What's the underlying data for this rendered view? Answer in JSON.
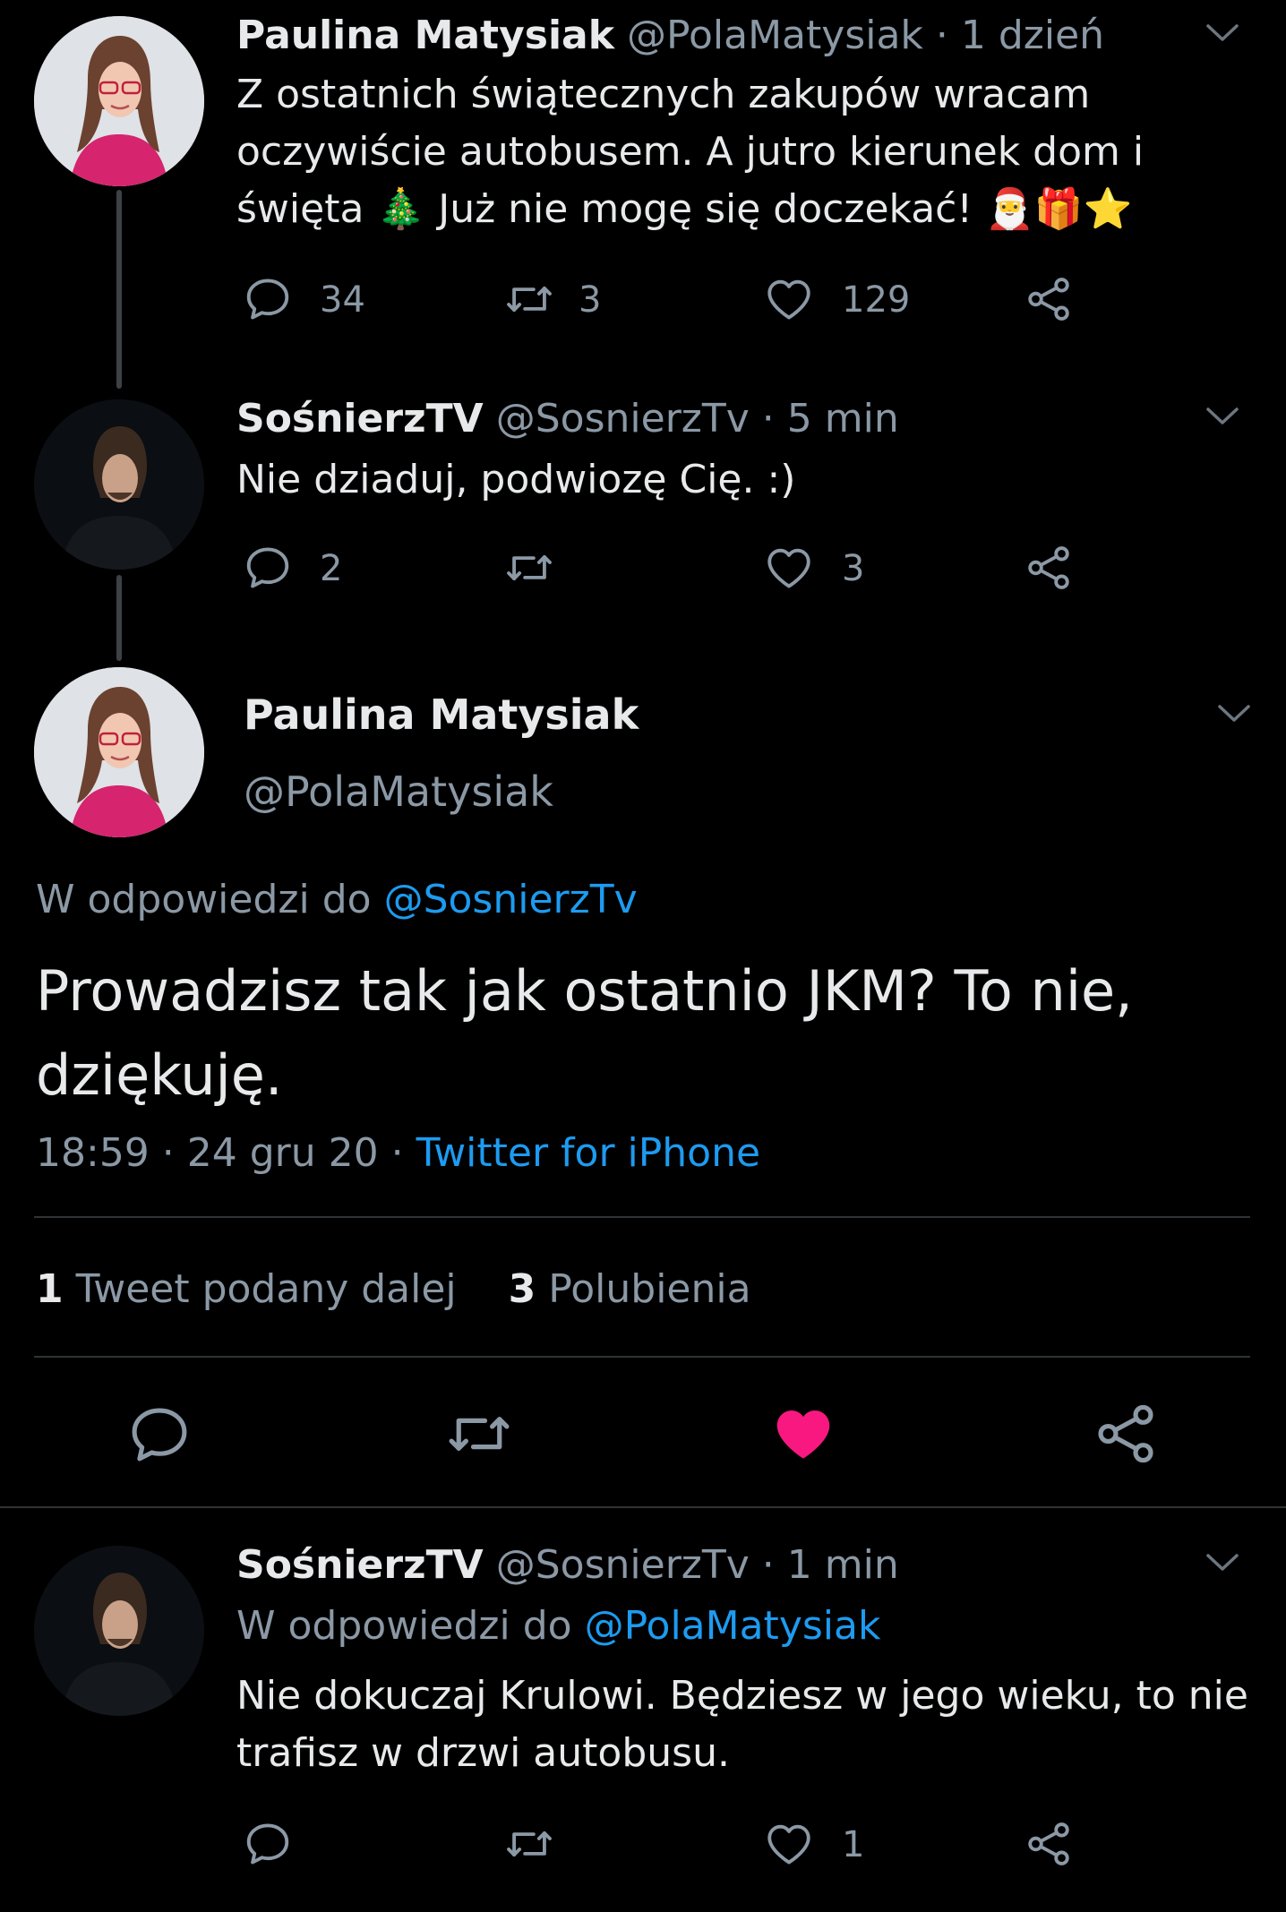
{
  "tweet1": {
    "name": "Paulina Matysiak",
    "handle": "@PolaMatysiak",
    "time": "· 1 dzień",
    "line1": "Z ostatnich świątecznych zakupów wracam",
    "line2": "oczywiście autobusem. A jutro kierunek dom i",
    "line3a": "święta",
    "line3b": "Już nie mogę się doczekać!",
    "emoji_tree": "🎄",
    "emoji_tail": "🎅🎁⭐",
    "replies": "34",
    "retweets": "3",
    "likes": "129"
  },
  "tweet2": {
    "name": "SośnierzTV",
    "handle": "@SosnierzTv",
    "time": "· 5 min",
    "text": "Nie dziaduj, podwiozę Cię. :)",
    "replies": "2",
    "retweets": "",
    "likes": "3"
  },
  "main": {
    "name": "Paulina Matysiak",
    "handle": "@PolaMatysiak",
    "reply_prefix": "W odpowiedzi do",
    "reply_to": "@SosnierzTv",
    "line1": "Prowadzisz tak jak ostatnio JKM? To nie,",
    "line2": "dziękuję.",
    "timestamp": "18:59 · 24 gru 20 ·",
    "source": "Twitter for iPhone",
    "retweet_count": "1",
    "retweet_label": "Tweet podany dalej",
    "like_count": "3",
    "like_label": "Polubienia"
  },
  "tweet3": {
    "name": "SośnierzTV",
    "handle": "@SosnierzTv",
    "time": "· 1 min",
    "reply_prefix": "W odpowiedzi do",
    "reply_to": "@PolaMatysiak",
    "line1": "Nie dokuczaj Krulowi. Będziesz w jego wieku, to nie",
    "line2": "trafisz w drzwi autobusu.",
    "replies": "",
    "retweets": "",
    "likes": "1"
  },
  "colors": {
    "background": "#000000",
    "text": "#e7e9ea",
    "muted": "#8b98a5",
    "link": "#1d9bf0",
    "like_active": "#f91880"
  },
  "icons": [
    "reply-icon",
    "retweet-icon",
    "heart-icon",
    "share-icon",
    "chevron-down-icon"
  ]
}
